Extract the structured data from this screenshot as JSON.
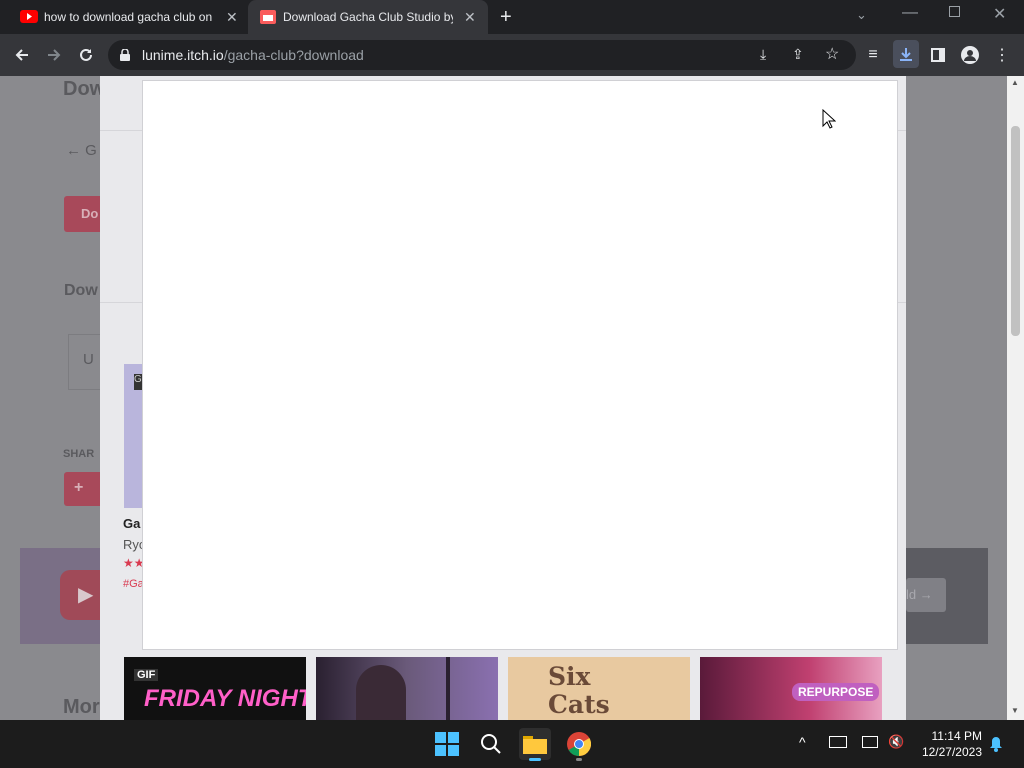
{
  "tabs": [
    {
      "title": "how to download gacha club on",
      "favicon": "youtube-icon",
      "active": false
    },
    {
      "title": "Download Gacha Club Studio by",
      "favicon": "itchio-icon",
      "active": true
    }
  ],
  "omnibox": {
    "host": "lunime.itch.io",
    "path": "/gacha-club?download"
  },
  "background_page": {
    "heading_fragment": "Dow",
    "back_link": "← G",
    "button_fragment": "Do",
    "download_fragment": "Dow",
    "input_fragment": "U",
    "share_label": "SHAR",
    "card": {
      "title": "Ga",
      "author": "Ryo",
      "tag": "#Ga",
      "badge": "G"
    },
    "more_fragment": "Mor",
    "nav_right": "ld →"
  },
  "thumbnails": [
    {
      "label": "GIF",
      "text": "FRIDAY NIGHT"
    },
    {
      "label": "",
      "text": ""
    },
    {
      "label": "",
      "text": "Six Cats Under"
    },
    {
      "label": "",
      "text": "REPURPOSE"
    }
  ],
  "taskbar": {
    "time": "11:14 PM",
    "date": "12/27/2023"
  },
  "colors": {
    "accent": "#fa5c5c",
    "chrome_dark": "#202124",
    "chrome_toolbar": "#35363a"
  }
}
